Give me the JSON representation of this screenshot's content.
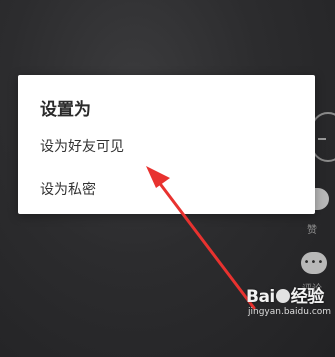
{
  "dialog": {
    "title": "设置为",
    "options": [
      {
        "label": "设为好友可见"
      },
      {
        "label": "设为私密"
      }
    ]
  },
  "side": {
    "like_label": "赞",
    "comment_label": "评论"
  },
  "watermark": {
    "brand": "Bai",
    "brand_suffix": "经验",
    "url": "jingyan.baidu.com"
  },
  "colors": {
    "arrow": "#e8322f",
    "dialog_bg": "#ffffff",
    "backdrop": "#2a2a2c"
  }
}
